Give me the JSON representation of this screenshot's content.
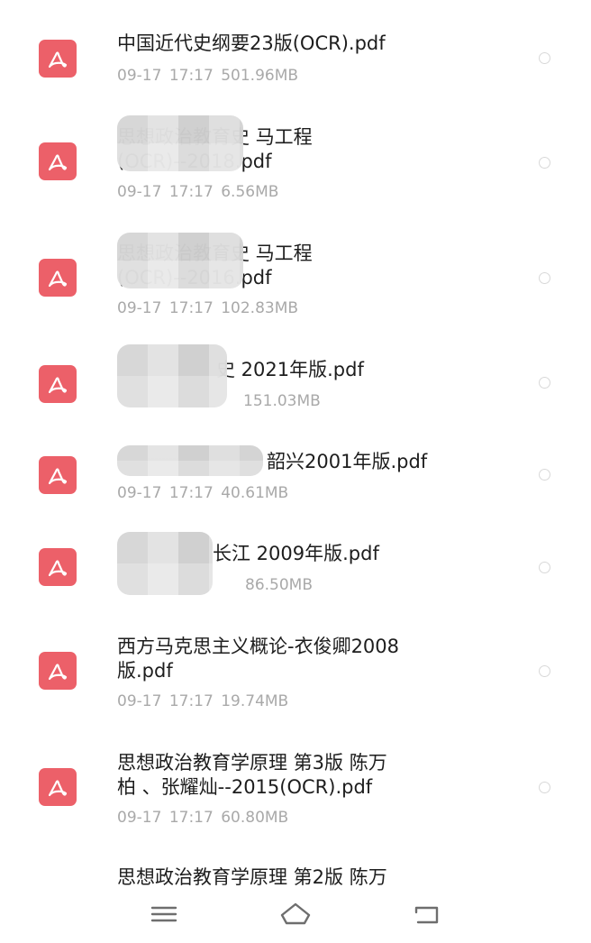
{
  "files": [
    {
      "name": "中国近代史纲要23版(OCR).pdf",
      "date": "09-17",
      "time": "17:17",
      "size": "501.96MB",
      "icon": "pdf-icon",
      "redacted": false
    },
    {
      "name": "思想政治教育史 马工程\n(OCR)--2018.pdf",
      "date": "09-17",
      "time": "17:17",
      "size": "6.56MB",
      "icon": "pdf-icon",
      "redacted": true
    },
    {
      "name": "思想政治教育史 马工程\n(OCR)--2016.pdf",
      "date": "09-17",
      "time": "17:17",
      "size": "102.83MB",
      "icon": "pdf-icon",
      "redacted": true
    },
    {
      "name": "史 2021年版.pdf",
      "date": "",
      "time": "",
      "size": "151.03MB",
      "icon": "pdf-icon",
      "redacted": true
    },
    {
      "name": "韶兴2001年版.pdf",
      "date": "09-17",
      "time": "17:17",
      "size": "40.61MB",
      "icon": "pdf-icon",
      "redacted": true
    },
    {
      "name": "长江 2009年版.pdf",
      "date": "",
      "time": "",
      "size": "86.50MB",
      "icon": "pdf-icon",
      "redacted": true
    },
    {
      "name": "西方马克思主义概论-衣俊卿2008\n版.pdf",
      "date": "09-17",
      "time": "17:17",
      "size": "19.74MB",
      "icon": "pdf-icon",
      "redacted": false
    },
    {
      "name": "思想政治教育学原理 第3版 陈万\n柏 、张耀灿--2015(OCR).pdf",
      "date": "09-17",
      "time": "17:17",
      "size": "60.80MB",
      "icon": "pdf-icon",
      "redacted": false
    },
    {
      "name": "思想政治教育学原理 第2版 陈万",
      "date": "",
      "time": "",
      "size": "",
      "icon": "pdf-icon",
      "redacted": false
    }
  ],
  "nav": {
    "menu_icon": "menu-icon",
    "home_icon": "home-icon",
    "back_icon": "back-icon"
  },
  "colors": {
    "pdf_icon": "#ec6069",
    "meta_text": "#a9a9a9",
    "name_text": "#1d1d1d"
  }
}
